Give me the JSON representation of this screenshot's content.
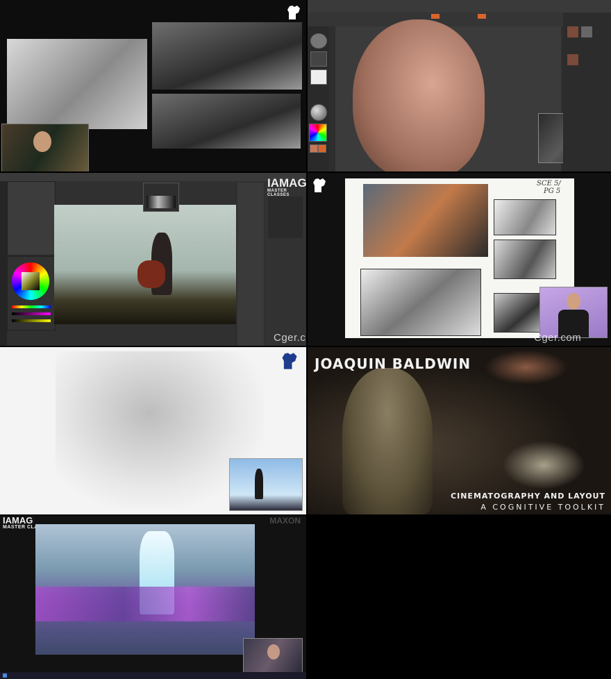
{
  "watermarks": {
    "left": "Cger.com",
    "right": "Cger.com"
  },
  "panel3": {
    "brand_line1": "IAMAG",
    "brand_line2": "MASTER CLASSES"
  },
  "panel6": {
    "presenter_name": "JOAQUIN BALDWIN",
    "subtitle_line1": "CINEMATOGRAPHY AND LAYOUT",
    "subtitle_line2": "A COGNITIVE TOOLKIT"
  },
  "panel7": {
    "brand_line1": "IAMAG",
    "brand_line2": "MASTER CLASSES",
    "sponsor": "MAXON"
  },
  "panel4": {
    "note_line1": "SCE 5/",
    "note_line2": "PG 5"
  },
  "colors": {
    "fist_white": "#ffffff",
    "fist_blue": "#1f3c8c",
    "zbrush_orange": "#d9642a"
  }
}
